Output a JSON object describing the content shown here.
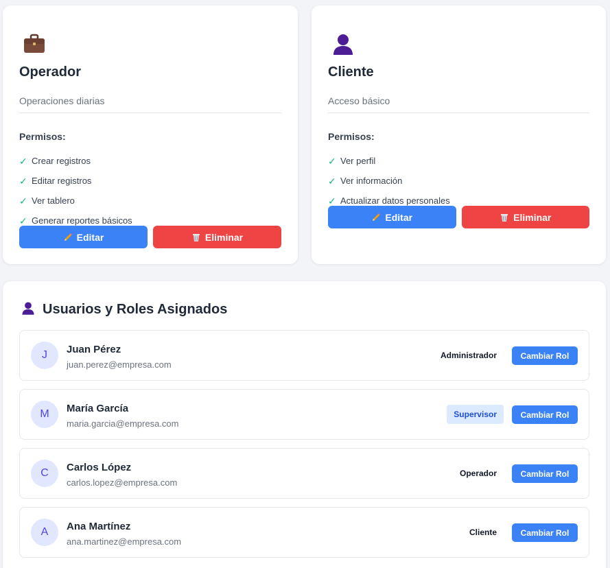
{
  "roles": [
    {
      "icon": "briefcase-icon",
      "title": "Operador",
      "description": "Operaciones diarias",
      "permissions_heading": "Permisos:",
      "permissions": [
        "Crear registros",
        "Editar registros",
        "Ver tablero",
        "Generar reportes básicos"
      ],
      "edit_label": "Editar",
      "delete_label": "Eliminar"
    },
    {
      "icon": "user-silhouette-icon",
      "title": "Cliente",
      "description": "Acceso básico",
      "permissions_heading": "Permisos:",
      "permissions": [
        "Ver perfil",
        "Ver información",
        "Actualizar datos personales"
      ],
      "edit_label": "Editar",
      "delete_label": "Eliminar"
    }
  ],
  "users_section": {
    "title": "Usuarios y Roles Asignados",
    "icon": "user-silhouette-icon",
    "change_role_label": "Cambiar Rol",
    "users": [
      {
        "initial": "J",
        "name": "Juan Pérez",
        "email": "juan.perez@empresa.com",
        "role": "Administrador",
        "highlighted": false
      },
      {
        "initial": "M",
        "name": "María García",
        "email": "maria.garcia@empresa.com",
        "role": "Supervisor",
        "highlighted": true
      },
      {
        "initial": "C",
        "name": "Carlos López",
        "email": "carlos.lopez@empresa.com",
        "role": "Operador",
        "highlighted": false
      },
      {
        "initial": "A",
        "name": "Ana Martínez",
        "email": "ana.martinez@empresa.com",
        "role": "Cliente",
        "highlighted": false
      }
    ]
  },
  "colors": {
    "primary": "#3b82f6",
    "danger": "#ef4444",
    "check": "#10b981",
    "avatar_bg": "#e0e7ff",
    "avatar_text": "#4f46e5"
  }
}
